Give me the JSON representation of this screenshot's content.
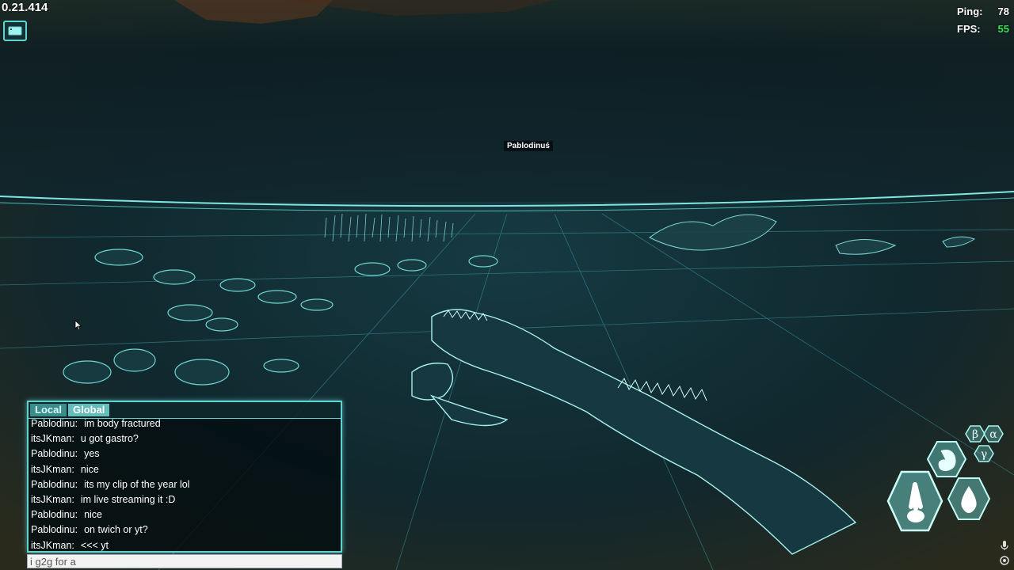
{
  "hud": {
    "version": "0.21.414",
    "ping_label": "Ping:",
    "ping_value": "78",
    "fps_label": "FPS:",
    "fps_value": "55",
    "camera_icon": "camera-icon",
    "accent_color": "#5fd3d0",
    "fps_color": "#3ee05a"
  },
  "world": {
    "player_nameplate": "Pablodinuś"
  },
  "chat": {
    "tabs": [
      {
        "label": "Local",
        "active": false
      },
      {
        "label": "Global",
        "active": true
      }
    ],
    "messages": [
      {
        "sender": "Pablodinu:",
        "text": "im body fractured"
      },
      {
        "sender": "itsJKman:",
        "text": "u got gastro?"
      },
      {
        "sender": "Pablodinu:",
        "text": "yes"
      },
      {
        "sender": "itsJKman:",
        "text": "nice"
      },
      {
        "sender": "Pablodinu:",
        "text": "its my clip of the year lol"
      },
      {
        "sender": "itsJKman:",
        "text": "im live streaming it :D"
      },
      {
        "sender": "Pablodinu:",
        "text": "nice"
      },
      {
        "sender": "Pablodinu:",
        "text": "on twich or yt?"
      },
      {
        "sender": "itsJKman:",
        "text": "<<< yt"
      }
    ],
    "input_value": "i g2g for a"
  },
  "status_hexes": {
    "icons": [
      "beta-icon",
      "alpha-icon",
      "gamma-icon",
      "stomach-icon",
      "footprint-icon",
      "water-drop-icon"
    ],
    "glyphs": {
      "beta": "β",
      "alpha": "α",
      "gamma": "γ"
    }
  },
  "corner_icons": [
    "microphone-icon",
    "settings-icon"
  ]
}
